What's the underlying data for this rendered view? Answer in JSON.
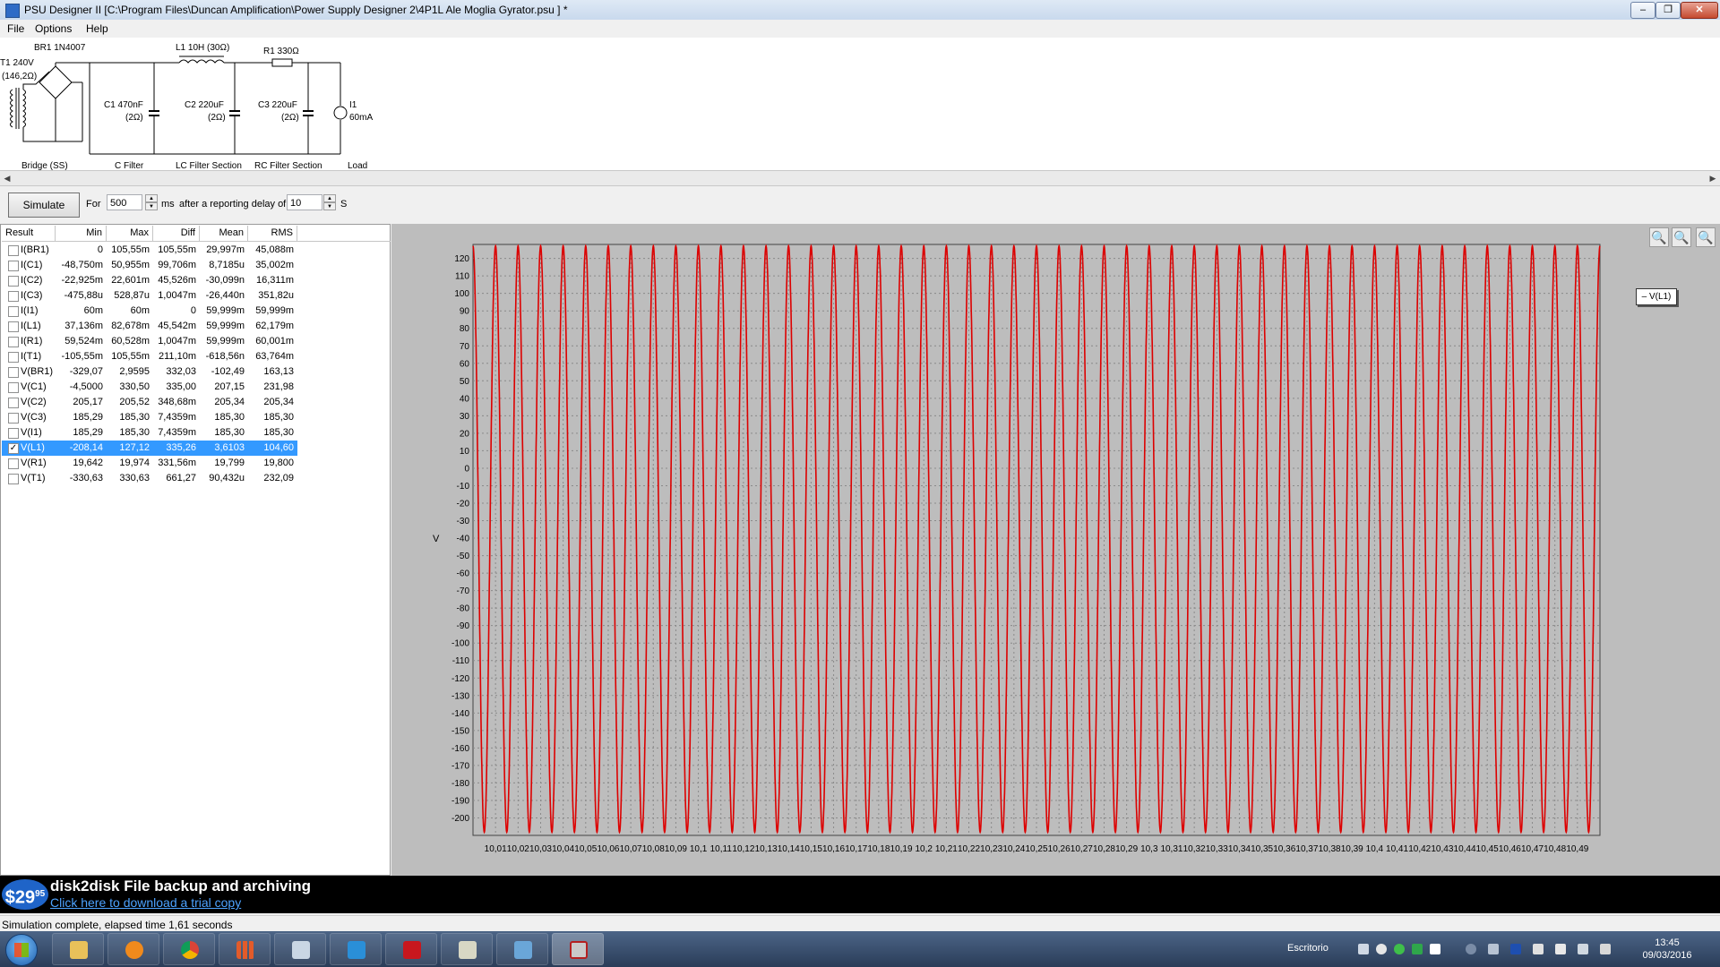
{
  "window": {
    "title": "PSU Designer II  [C:\\Program Files\\Duncan Amplification\\Power Supply Designer 2\\4P1L Ale Moglia Gyrator.psu ] *"
  },
  "menu": [
    "File",
    "Options",
    "Help"
  ],
  "schematic": {
    "transformer": "T1 240V",
    "transformer_res": "(146,2Ω)",
    "bridge": "BR1 1N4007",
    "c1": "C1 470nF",
    "c1_res": "(2Ω)",
    "l1": "L1 10H (30Ω)",
    "c2": "C2 220uF",
    "c2_res": "(2Ω)",
    "r1": "R1 330Ω",
    "c3": "C3 220uF",
    "c3_res": "(2Ω)",
    "i1": "I1",
    "i1_val": "60mA",
    "sections": [
      "Bridge (SS)",
      "C Filter",
      "LC Filter Section",
      "RC Filter Section",
      "Load"
    ]
  },
  "simbar": {
    "simulate_label": "Simulate",
    "for_label": "For",
    "duration_value": "500",
    "ms_label": "ms",
    "delay_text": "after a reporting delay of",
    "delay_value": "10",
    "s_label": "S"
  },
  "results": {
    "headers": [
      "Result",
      "Min",
      "Max",
      "Diff",
      "Mean",
      "RMS"
    ],
    "rows": [
      {
        "name": "I(BR1)",
        "min": "0",
        "max": "105,55m",
        "diff": "105,55m",
        "mean": "29,997m",
        "rms": "45,088m",
        "checked": false
      },
      {
        "name": "I(C1)",
        "min": "-48,750m",
        "max": "50,955m",
        "diff": "99,706m",
        "mean": "8,7185u",
        "rms": "35,002m",
        "checked": false
      },
      {
        "name": "I(C2)",
        "min": "-22,925m",
        "max": "22,601m",
        "diff": "45,526m",
        "mean": "-30,099n",
        "rms": "16,311m",
        "checked": false
      },
      {
        "name": "I(C3)",
        "min": "-475,88u",
        "max": "528,87u",
        "diff": "1,0047m",
        "mean": "-26,440n",
        "rms": "351,82u",
        "checked": false
      },
      {
        "name": "I(I1)",
        "min": "60m",
        "max": "60m",
        "diff": "0",
        "mean": "59,999m",
        "rms": "59,999m",
        "checked": false
      },
      {
        "name": "I(L1)",
        "min": "37,136m",
        "max": "82,678m",
        "diff": "45,542m",
        "mean": "59,999m",
        "rms": "62,179m",
        "checked": false
      },
      {
        "name": "I(R1)",
        "min": "59,524m",
        "max": "60,528m",
        "diff": "1,0047m",
        "mean": "59,999m",
        "rms": "60,001m",
        "checked": false
      },
      {
        "name": "I(T1)",
        "min": "-105,55m",
        "max": "105,55m",
        "diff": "211,10m",
        "mean": "-618,56n",
        "rms": "63,764m",
        "checked": false
      },
      {
        "name": "V(BR1)",
        "min": "-329,07",
        "max": "2,9595",
        "diff": "332,03",
        "mean": "-102,49",
        "rms": "163,13",
        "checked": false
      },
      {
        "name": "V(C1)",
        "min": "-4,5000",
        "max": "330,50",
        "diff": "335,00",
        "mean": "207,15",
        "rms": "231,98",
        "checked": false
      },
      {
        "name": "V(C2)",
        "min": "205,17",
        "max": "205,52",
        "diff": "348,68m",
        "mean": "205,34",
        "rms": "205,34",
        "checked": false
      },
      {
        "name": "V(C3)",
        "min": "185,29",
        "max": "185,30",
        "diff": "7,4359m",
        "mean": "185,30",
        "rms": "185,30",
        "checked": false
      },
      {
        "name": "V(I1)",
        "min": "185,29",
        "max": "185,30",
        "diff": "7,4359m",
        "mean": "185,30",
        "rms": "185,30",
        "checked": false
      },
      {
        "name": "V(L1)",
        "min": "-208,14",
        "max": "127,12",
        "diff": "335,26",
        "mean": "3,6103",
        "rms": "104,60",
        "checked": true
      },
      {
        "name": "V(R1)",
        "min": "19,642",
        "max": "19,974",
        "diff": "331,56m",
        "mean": "19,799",
        "rms": "19,800",
        "checked": false
      },
      {
        "name": "V(T1)",
        "min": "-330,63",
        "max": "330,63",
        "diff": "661,27",
        "mean": "90,432u",
        "rms": "232,09",
        "checked": false
      }
    ]
  },
  "chart_data": {
    "type": "line",
    "ylabel": "V",
    "ylim": [
      -210,
      128
    ],
    "xlim": [
      10.0,
      10.5
    ],
    "yticks": [
      120,
      110,
      100,
      90,
      80,
      70,
      60,
      50,
      40,
      30,
      20,
      10,
      0,
      -10,
      -20,
      -30,
      -40,
      -50,
      -60,
      -70,
      -80,
      -90,
      -100,
      -110,
      -120,
      -130,
      -140,
      -150,
      -160,
      -170,
      -180,
      -190,
      -200
    ],
    "xtick_labels": [
      "10,01",
      "10,02",
      "10,03",
      "10,04",
      "10,05",
      "10,06",
      "10,07",
      "10,08",
      "10,09",
      "10,1",
      "10,11",
      "10,12",
      "10,13",
      "10,14",
      "10,15",
      "10,16",
      "10,17",
      "10,18",
      "10,19",
      "10,2",
      "10,21",
      "10,22",
      "10,23",
      "10,24",
      "10,25",
      "10,26",
      "10,27",
      "10,28",
      "10,29",
      "10,3",
      "10,31",
      "10,32",
      "10,33",
      "10,34",
      "10,35",
      "10,36",
      "10,37",
      "10,38",
      "10,39",
      "10,4",
      "10,41",
      "10,42",
      "10,43",
      "10,44",
      "10,45",
      "10,46",
      "10,47",
      "10,48",
      "10,49"
    ],
    "grid": true,
    "series": [
      {
        "name": "V(L1)",
        "color": "#dd0000",
        "frequency_hz": 100,
        "max": 127.12,
        "min": -208.14
      }
    ],
    "legend_position": "right"
  },
  "banner": {
    "price": "$29",
    "price_cents": "95",
    "title": "disk2disk File backup and archiving",
    "link": "Click here to download a trial copy"
  },
  "status": {
    "text": "Simulation complete, elapsed time 1,61 seconds"
  },
  "taskbar": {
    "desktop_label": "Escritorio",
    "time": "13:45",
    "date": "09/03/2016"
  }
}
